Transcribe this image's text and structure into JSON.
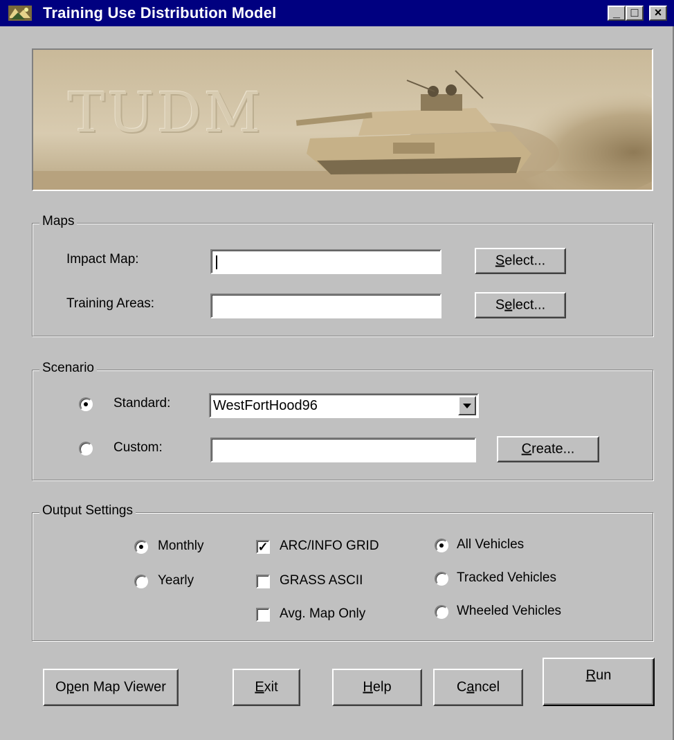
{
  "window": {
    "title": "Training Use Distribution Model",
    "controls": {
      "minimize": "_",
      "maximize": "□",
      "close": "×"
    }
  },
  "banner": {
    "text": "TUDM"
  },
  "maps": {
    "legend": "Maps",
    "impact_label": "Impact Map:",
    "impact_value": "",
    "training_label": "Training Areas:",
    "training_value": "",
    "select_pre": "",
    "select_key": "S",
    "select_post": "elect...",
    "select2_pre": "S",
    "select2_key": "e",
    "select2_post": "lect..."
  },
  "scenario": {
    "legend": "Scenario",
    "standard_label": "Standard:",
    "standard_value": "WestFortHood96",
    "standard_selected": true,
    "custom_label": "Custom:",
    "custom_value": "",
    "custom_selected": false,
    "create_key": "C",
    "create_post": "reate..."
  },
  "output": {
    "legend": "Output Settings",
    "period": [
      {
        "label": "Monthly",
        "selected": true
      },
      {
        "label": "Yearly",
        "selected": false
      }
    ],
    "formats": [
      {
        "label": "ARC/INFO GRID",
        "checked": true
      },
      {
        "label": "GRASS ASCII",
        "checked": false
      },
      {
        "label": "Avg. Map Only",
        "checked": false
      }
    ],
    "vehicles": [
      {
        "label": "All Vehicles",
        "selected": true
      },
      {
        "label": "Tracked Vehicles",
        "selected": false
      },
      {
        "label": "Wheeled Vehicles",
        "selected": false
      }
    ]
  },
  "buttons": {
    "open_map_pre": "O",
    "open_map_key": "p",
    "open_map_post": "en Map Viewer",
    "exit_key": "E",
    "exit_post": "xit",
    "help_key": "H",
    "help_post": "elp",
    "cancel_pre": "C",
    "cancel_key": "a",
    "cancel_post": "ncel",
    "run_key": "R",
    "run_post": "un"
  },
  "colors": {
    "titlebar": "#000080",
    "face": "#c0c0c0"
  }
}
